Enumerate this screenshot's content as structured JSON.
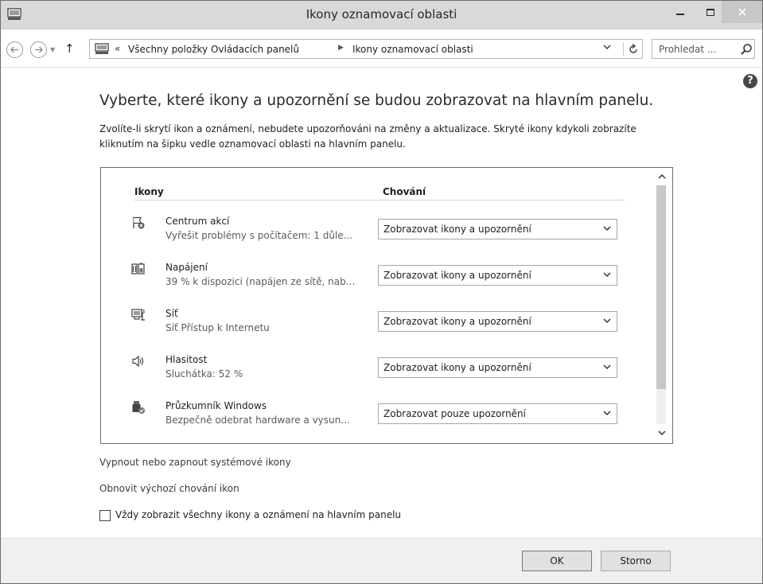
{
  "window": {
    "title": "Ikony oznamovací oblasti"
  },
  "address_bar": {
    "overflow": "«",
    "crumbs": [
      "Všechny položky Ovládacích panelů",
      "Ikony oznamovací oblasti"
    ]
  },
  "search": {
    "placeholder": "Prohledat ..."
  },
  "content": {
    "heading": "Vyberte, které ikony a upozornění se budou zobrazovat na hlavním panelu.",
    "description": "Zvolíte-li skrytí ikon a oznámení, nebudete upozorňováni na změny a aktualizace. Skryté ikony kdykoli zobrazíte kliknutím na šipku vedle oznamovací oblasti na hlavním panelu."
  },
  "table": {
    "col_icons": "Ikony",
    "col_behavior": "Chování",
    "rows": [
      {
        "name": "Centrum akcí",
        "sub": "Vyřešit problémy s počítačem: 1 důle...",
        "behavior": "Zobrazovat ikony a upozornění",
        "icon": "flag-icon"
      },
      {
        "name": "Napájení",
        "sub": "39 % k dispozici (napájen ze sítě, nab...",
        "behavior": "Zobrazovat ikony a upozornění",
        "icon": "battery-icon"
      },
      {
        "name": "Síť",
        "sub": "Síť Přístup k Internetu",
        "behavior": "Zobrazovat ikony a upozornění",
        "icon": "network-icon"
      },
      {
        "name": "Hlasitost",
        "sub": "Sluchátka: 52 %",
        "behavior": "Zobrazovat ikony a upozornění",
        "icon": "speaker-icon"
      },
      {
        "name": "Průzkumník Windows",
        "sub": "Bezpečně odebrat hardware a vysun...",
        "behavior": "Zobrazovat pouze upozornění",
        "icon": "usb-drive-icon"
      }
    ]
  },
  "links": {
    "system_icons": "Vypnout nebo zapnout systémové ikony",
    "restore": "Obnovit výchozí chování ikon"
  },
  "checkbox": {
    "label": "Vždy zobrazit všechny ikony a oznámení na hlavním panelu",
    "checked": false
  },
  "buttons": {
    "ok": "OK",
    "cancel": "Storno"
  }
}
